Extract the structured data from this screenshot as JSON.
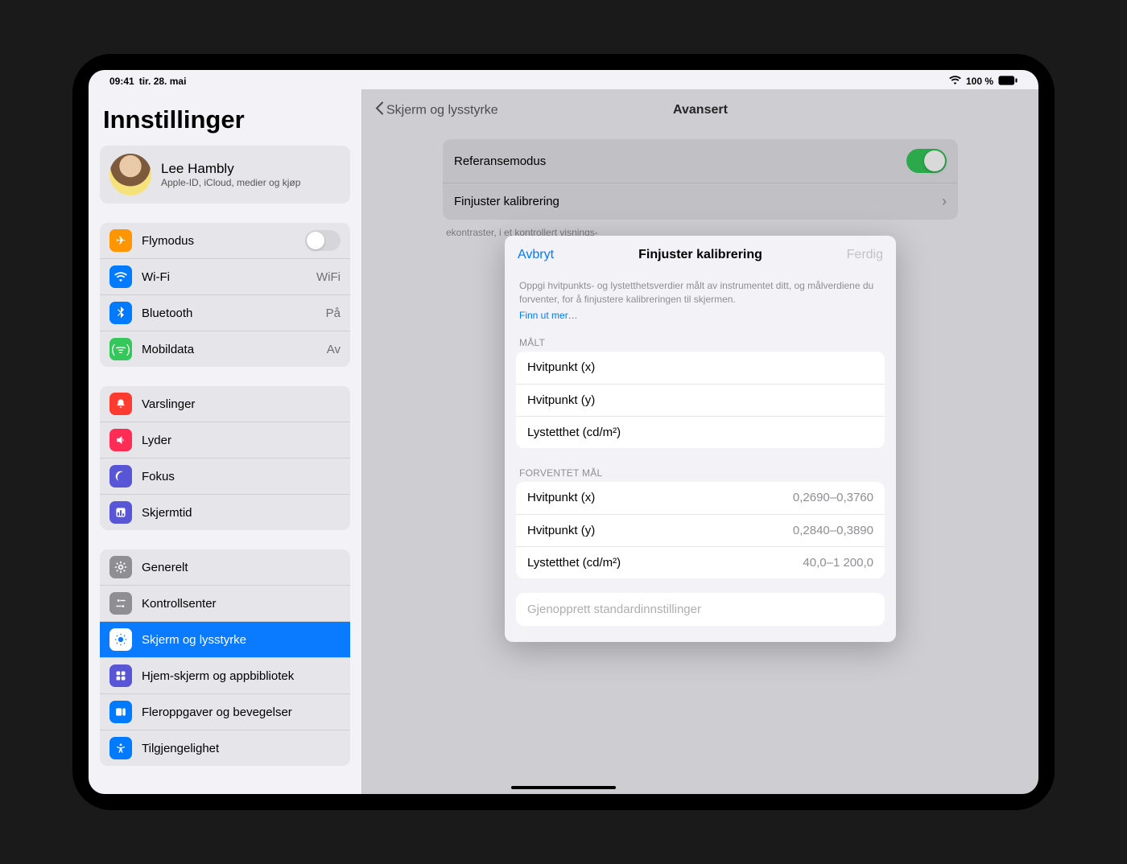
{
  "status": {
    "time": "09:41",
    "date": "tir. 28. mai",
    "battery_pct": "100 %"
  },
  "sidebar": {
    "title": "Innstillinger",
    "profile": {
      "name": "Lee Hambly",
      "subtitle": "Apple-ID, iCloud, medier og kjøp"
    },
    "group1": [
      {
        "label": "Flymodus",
        "value": "",
        "icon": "airplane-icon"
      },
      {
        "label": "Wi-Fi",
        "value": "WiFi",
        "icon": "wifi-icon"
      },
      {
        "label": "Bluetooth",
        "value": "På",
        "icon": "bluetooth-icon"
      },
      {
        "label": "Mobildata",
        "value": "Av",
        "icon": "mobile-data-icon"
      }
    ],
    "group2": [
      {
        "label": "Varslinger",
        "icon": "notifications-icon"
      },
      {
        "label": "Lyder",
        "icon": "sounds-icon"
      },
      {
        "label": "Fokus",
        "icon": "focus-icon"
      },
      {
        "label": "Skjermtid",
        "icon": "screentime-icon"
      }
    ],
    "group3": [
      {
        "label": "Generelt",
        "icon": "general-icon"
      },
      {
        "label": "Kontrollsenter",
        "icon": "control-center-icon"
      },
      {
        "label": "Skjerm og lysstyrke",
        "icon": "brightness-icon",
        "selected": true
      },
      {
        "label": "Hjem-skjerm og appbibliotek",
        "icon": "home-screen-icon"
      },
      {
        "label": "Fleroppgaver og bevegelser",
        "icon": "multitask-icon"
      },
      {
        "label": "Tilgjengelighet",
        "icon": "accessibility-icon"
      }
    ]
  },
  "content": {
    "back_label": "Skjerm og lysstyrke",
    "title": "Avansert",
    "rows": {
      "reference_mode": "Referansemodus",
      "fine_tune": "Finjuster kalibrering"
    },
    "footer": "ekontraster, i et kontrollert visnings-"
  },
  "sheet": {
    "cancel": "Avbryt",
    "done": "Ferdig",
    "title": "Finjuster kalibrering",
    "intro": "Oppgi hvitpunkts- og lystetthetsverdier målt av instrumentet ditt, og målverdiene du forventer, for å finjustere kalibreringen til skjermen.",
    "learn_more": "Finn ut mer…",
    "measured_header": "MÅLT",
    "target_header": "FORVENTET MÅL",
    "fields": {
      "white_x": "Hvitpunkt (x)",
      "white_y": "Hvitpunkt (y)",
      "lum": "Lystetthet (cd/m²)"
    },
    "placeholders": {
      "white_x": "0,2690–0,3760",
      "white_y": "0,2840–0,3890",
      "lum": "40,0–1 200,0"
    },
    "restore": "Gjenopprett standardinnstillinger"
  }
}
